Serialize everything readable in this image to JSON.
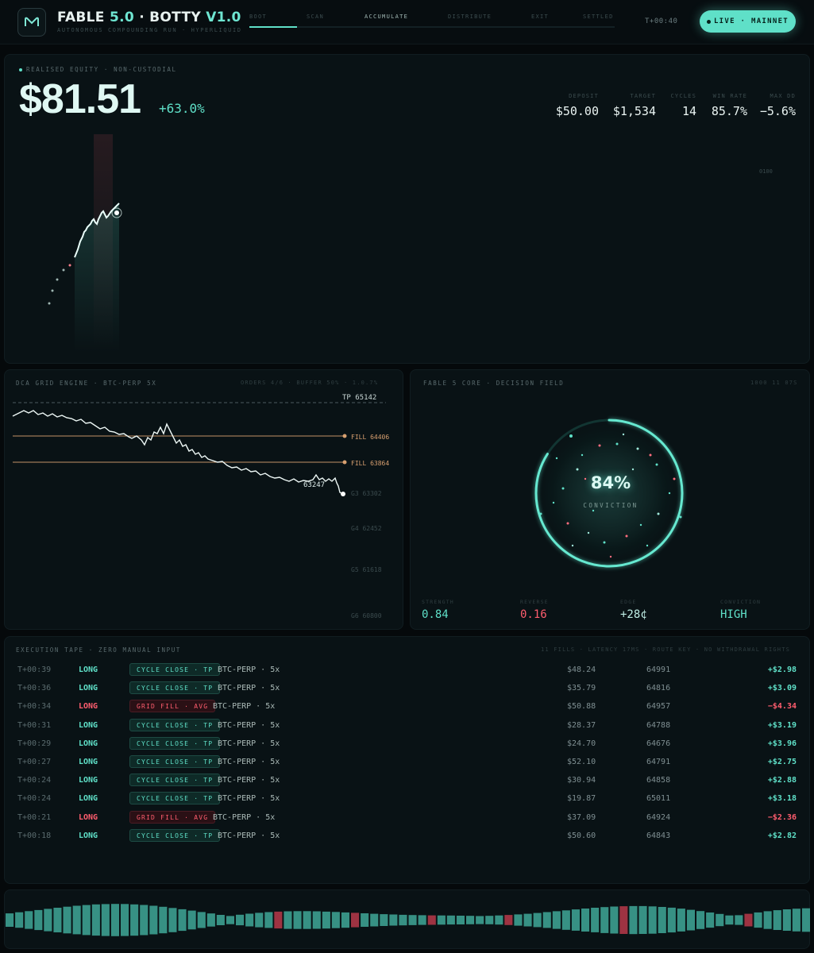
{
  "header": {
    "brand_name": "FABLE",
    "brand_version": "5.0",
    "brand_sep": "·",
    "product": "BOTTY",
    "product_version": "V1.0",
    "tagline": "AUTONOMOUS COMPOUNDING RUN · HYPERLIQUID",
    "steps": [
      "BOOT",
      "SCAN",
      "ACCUMULATE",
      "DISTRIBUTE",
      "EXIT",
      "SETTLED"
    ],
    "active_step": "ACCUMULATE",
    "progress": 0.13,
    "clock": "T+00:40",
    "live_label": "LIVE · MAINNET"
  },
  "equity": {
    "label": "REALISED EQUITY · NON-CUSTODIAL",
    "value": "$81.51",
    "change": "+63.0%",
    "stats": [
      {
        "label": "DEPOSIT",
        "value": "$50.00"
      },
      {
        "label": "TARGET",
        "value": "$1,534"
      },
      {
        "label": "CYCLES",
        "value": "14"
      },
      {
        "label": "WIN RATE",
        "value": "85.7%"
      },
      {
        "label": "MAX DD",
        "value": "−5.6%"
      }
    ],
    "marker": "0100"
  },
  "grid": {
    "title": "DCA GRID ENGINE · BTC-PERP 5X",
    "meta": "ORDERS 4/6 · BUFFER 50% · 1.0.7%",
    "levels": [
      {
        "label": "TP 65142",
        "kind": "tp"
      },
      {
        "label": "FILL 64406",
        "kind": "fill"
      },
      {
        "label": "FILL 63864",
        "kind": "fill"
      },
      {
        "label": "G3 63302",
        "kind": "pending"
      },
      {
        "label": "G4 62452",
        "kind": "pending"
      },
      {
        "label": "G5 61618",
        "kind": "pending"
      },
      {
        "label": "G6 60800",
        "kind": "pending"
      }
    ],
    "last_price": "63247"
  },
  "core": {
    "title": "FABLE 5 CORE · DECISION FIELD",
    "meta": "1000 11 07S",
    "conviction_value": "84%",
    "conviction_fraction": 0.84,
    "conviction_label": "CONVICTION",
    "metrics": [
      {
        "label": "STRENGTH",
        "value": "0.84",
        "color": "#5fe0c8"
      },
      {
        "label": "REVERSE",
        "value": "0.16",
        "color": "#ff5d6e"
      },
      {
        "label": "EDGE",
        "value": "+28¢",
        "color": "#bfeee5"
      },
      {
        "label": "CONVICTION",
        "value": "HIGH",
        "color": "#5fe0c8"
      }
    ]
  },
  "tape": {
    "title": "EXECUTION TAPE · ZERO MANUAL INPUT",
    "meta": "11 FILLS · LATENCY 17MS · ROUTE KEY · NO WITHDRAWAL RIGHTS",
    "rows": [
      {
        "time": "T+00:39",
        "side": "LONG",
        "side_color": "#5fe0c8",
        "tag": "CYCLE CLOSE · TP",
        "tag_kind": "tp",
        "symbol": "BTC-PERP · 5x",
        "amount": "$48.24",
        "price": "64991",
        "pnl": "+$2.98",
        "pnl_color": "#5fe0c8"
      },
      {
        "time": "T+00:36",
        "side": "LONG",
        "side_color": "#5fe0c8",
        "tag": "CYCLE CLOSE · TP",
        "tag_kind": "tp",
        "symbol": "BTC-PERP · 5x",
        "amount": "$35.79",
        "price": "64816",
        "pnl": "+$3.09",
        "pnl_color": "#5fe0c8"
      },
      {
        "time": "T+00:34",
        "side": "LONG",
        "side_color": "#ff5d6e",
        "tag": "GRID FILL · AVG",
        "tag_kind": "fill",
        "symbol": "BTC-PERP · 5x",
        "amount": "$50.88",
        "price": "64957",
        "pnl": "−$4.34",
        "pnl_color": "#ff5d6e"
      },
      {
        "time": "T+00:31",
        "side": "LONG",
        "side_color": "#5fe0c8",
        "tag": "CYCLE CLOSE · TP",
        "tag_kind": "tp",
        "symbol": "BTC-PERP · 5x",
        "amount": "$28.37",
        "price": "64788",
        "pnl": "+$3.19",
        "pnl_color": "#5fe0c8"
      },
      {
        "time": "T+00:29",
        "side": "LONG",
        "side_color": "#5fe0c8",
        "tag": "CYCLE CLOSE · TP",
        "tag_kind": "tp",
        "symbol": "BTC-PERP · 5x",
        "amount": "$24.70",
        "price": "64676",
        "pnl": "+$3.96",
        "pnl_color": "#5fe0c8"
      },
      {
        "time": "T+00:27",
        "side": "LONG",
        "side_color": "#5fe0c8",
        "tag": "CYCLE CLOSE · TP",
        "tag_kind": "tp",
        "symbol": "BTC-PERP · 5x",
        "amount": "$52.10",
        "price": "64791",
        "pnl": "+$2.75",
        "pnl_color": "#5fe0c8"
      },
      {
        "time": "T+00:24",
        "side": "LONG",
        "side_color": "#5fe0c8",
        "tag": "CYCLE CLOSE · TP",
        "tag_kind": "tp",
        "symbol": "BTC-PERP · 5x",
        "amount": "$30.94",
        "price": "64858",
        "pnl": "+$2.88",
        "pnl_color": "#5fe0c8"
      },
      {
        "time": "T+00:24",
        "side": "LONG",
        "side_color": "#5fe0c8",
        "tag": "CYCLE CLOSE · TP",
        "tag_kind": "tp",
        "symbol": "BTC-PERP · 5x",
        "amount": "$19.87",
        "price": "65011",
        "pnl": "+$3.18",
        "pnl_color": "#5fe0c8"
      },
      {
        "time": "T+00:21",
        "side": "LONG",
        "side_color": "#ff5d6e",
        "tag": "GRID FILL · AVG",
        "tag_kind": "fill",
        "symbol": "BTC-PERP · 5x",
        "amount": "$37.09",
        "price": "64924",
        "pnl": "−$2.36",
        "pnl_color": "#ff5d6e"
      },
      {
        "time": "T+00:18",
        "side": "LONG",
        "side_color": "#5fe0c8",
        "tag": "CYCLE CLOSE · TP",
        "tag_kind": "tp",
        "symbol": "BTC-PERP · 5x",
        "amount": "$50.60",
        "price": "64843",
        "pnl": "+$2.82",
        "pnl_color": "#5fe0c8"
      }
    ]
  },
  "colors": {
    "accent": "#5fe0c8",
    "negative": "#ff5d6e",
    "fill_line": "#d8a070",
    "background": "#05090b"
  }
}
